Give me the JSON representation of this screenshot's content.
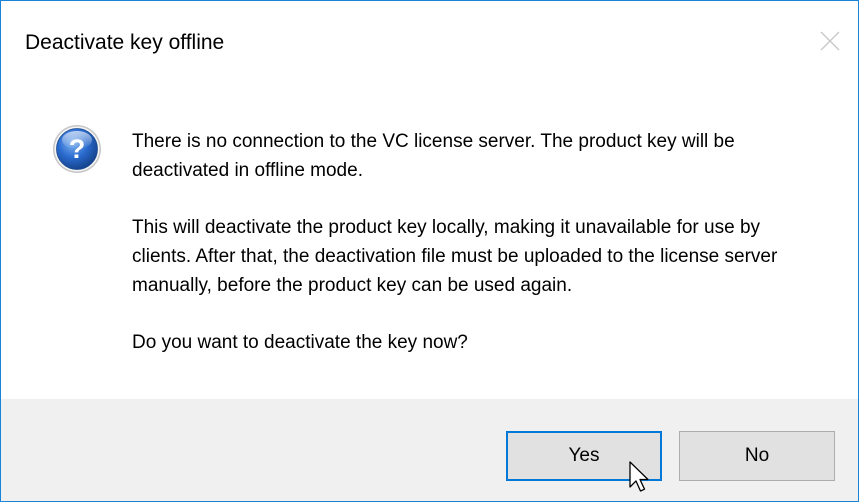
{
  "window": {
    "title": "Deactivate key offline",
    "close_icon": "close-icon"
  },
  "message": {
    "icon": "question-icon",
    "paragraph1": "There is no connection to the VC license server. The product key will be deactivated in offline mode.",
    "paragraph2": "This will deactivate the product key locally, making it unavailable for use by clients. After that, the deactivation file must be uploaded to the license server manually, before the product key can be used again.",
    "paragraph3": "Do you want to deactivate the key now?"
  },
  "buttons": {
    "yes_label": "Yes",
    "no_label": "No"
  },
  "colors": {
    "accent": "#0078d7",
    "footer_bg": "#f0f0f0",
    "button_bg": "#e1e1e1"
  }
}
